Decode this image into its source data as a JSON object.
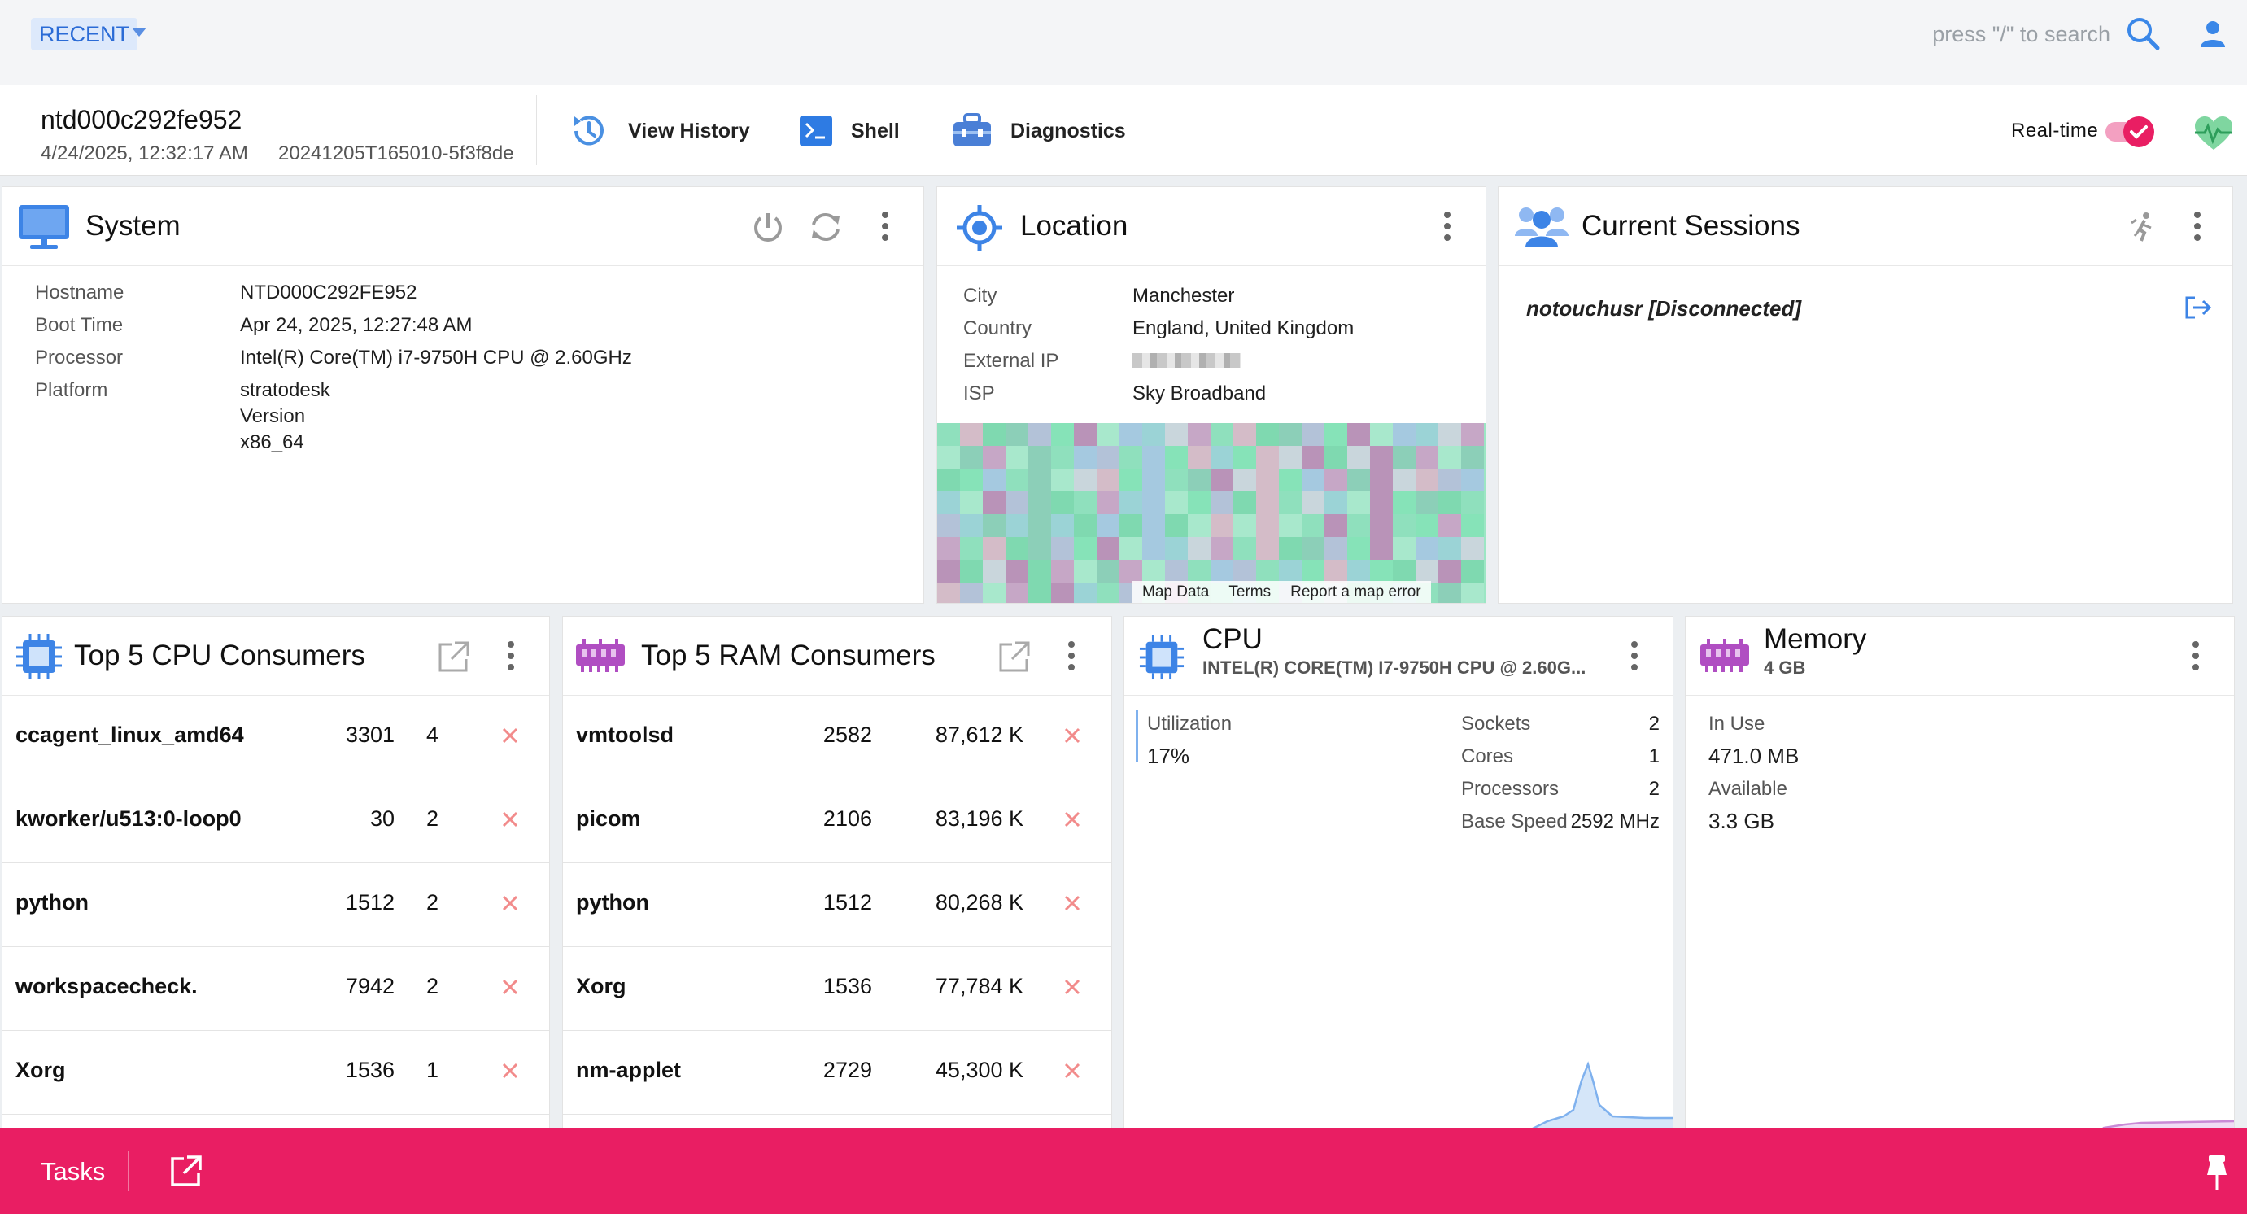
{
  "topbar": {
    "recent_label": "RECENT",
    "search_placeholder": "press \"/\" to search"
  },
  "device": {
    "name": "ntd000c292fe952",
    "timestamp": "4/24/2025, 12:32:17 AM",
    "build": "20241205T165010-5f3f8de",
    "actions": {
      "history": "View History",
      "shell": "Shell",
      "diagnostics": "Diagnostics"
    },
    "realtime_label": "Real-time",
    "realtime_on": true
  },
  "system": {
    "title": "System",
    "fields": [
      {
        "label": "Hostname",
        "value": "NTD000C292FE952"
      },
      {
        "label": "Boot Time",
        "value": "Apr 24, 2025, 12:27:48 AM"
      },
      {
        "label": "Processor",
        "value": "Intel(R) Core(TM) i7-9750H CPU @ 2.60GHz"
      },
      {
        "label": "Platform",
        "value": "stratodesk"
      }
    ],
    "platform_extra": [
      "Version",
      "x86_64"
    ]
  },
  "location": {
    "title": "Location",
    "fields": [
      {
        "label": "City",
        "value": "Manchester"
      },
      {
        "label": "Country",
        "value": "England, United Kingdom"
      },
      {
        "label": "External IP",
        "value": ""
      },
      {
        "label": "ISP",
        "value": "Sky Broadband"
      }
    ],
    "map_footer": [
      "Map Data",
      "Terms",
      "Report a map error"
    ]
  },
  "sessions": {
    "title": "Current Sessions",
    "items": [
      {
        "user": "notouchusr [Disconnected]"
      }
    ]
  },
  "cpu_consumers": {
    "title": "Top 5 CPU Consumers",
    "rows": [
      {
        "name": "ccagent_linux_amd64",
        "pid": "3301",
        "value": "4"
      },
      {
        "name": "kworker/u513:0-loop0",
        "pid": "30",
        "value": "2"
      },
      {
        "name": "python",
        "pid": "1512",
        "value": "2"
      },
      {
        "name": "workspacecheck.",
        "pid": "7942",
        "value": "2"
      },
      {
        "name": "Xorg",
        "pid": "1536",
        "value": "1"
      }
    ]
  },
  "ram_consumers": {
    "title": "Top 5 RAM Consumers",
    "rows": [
      {
        "name": "vmtoolsd",
        "pid": "2582",
        "value": "87,612 K"
      },
      {
        "name": "picom",
        "pid": "2106",
        "value": "83,196 K"
      },
      {
        "name": "python",
        "pid": "1512",
        "value": "80,268 K"
      },
      {
        "name": "Xorg",
        "pid": "1536",
        "value": "77,784 K"
      },
      {
        "name": "nm-applet",
        "pid": "2729",
        "value": "45,300 K"
      }
    ]
  },
  "cpu": {
    "title": "CPU",
    "subtitle": "INTEL(R) CORE(TM) I7-9750H CPU @ 2.60G...",
    "utilization_label": "Utilization",
    "utilization_value": "17%",
    "specs": [
      {
        "label": "Sockets",
        "value": "2"
      },
      {
        "label": "Cores",
        "value": "1"
      },
      {
        "label": "Processors",
        "value": "2"
      },
      {
        "label": "Base Speed",
        "value": "2592 MHz"
      }
    ]
  },
  "memory": {
    "title": "Memory",
    "subtitle": "4 GB",
    "inuse_label": "In Use",
    "inuse_value": "471.0 MB",
    "available_label": "Available",
    "available_value": "3.3 GB"
  },
  "taskbar": {
    "label": "Tasks"
  },
  "colors": {
    "accent": "#e91e63",
    "link": "#2a6bd6",
    "kill": "#f28b8b"
  }
}
